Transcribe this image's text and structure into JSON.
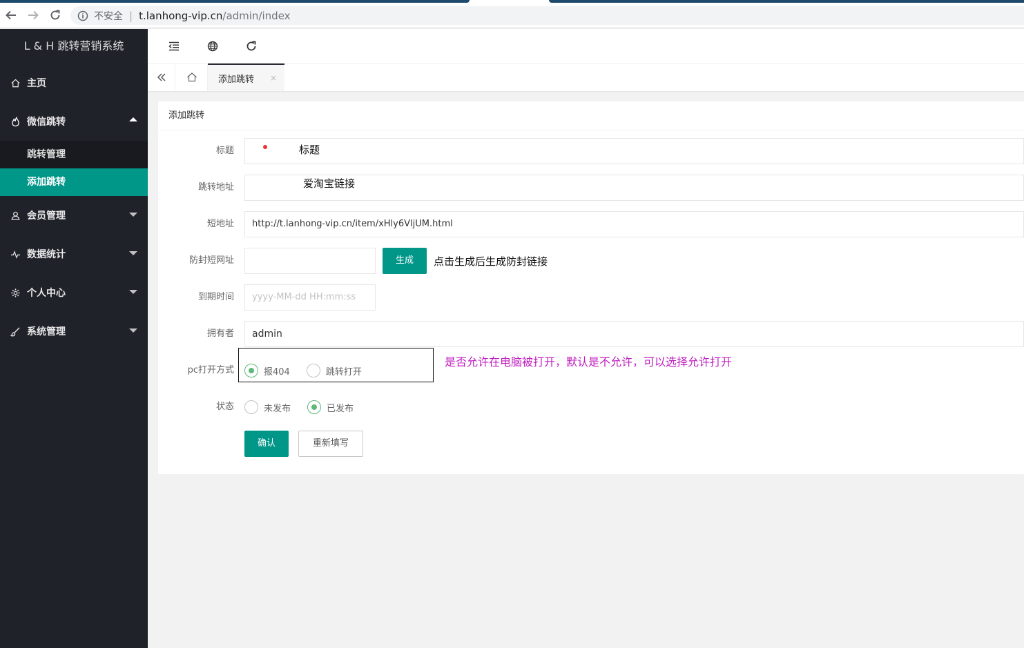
{
  "browser": {
    "insecure_label": "不安全",
    "url_host": "t.lanhong-vip.cn",
    "url_path": "/admin/index"
  },
  "sidebar": {
    "logo": "L & H 跳转营销系统",
    "items": [
      {
        "label": "主页",
        "icon": "home-icon"
      },
      {
        "label": "微信跳转",
        "icon": "fire-icon",
        "expanded": true
      },
      {
        "label": "会员管理",
        "icon": "user-icon"
      },
      {
        "label": "数据统计",
        "icon": "pulse-icon"
      },
      {
        "label": "个人中心",
        "icon": "gear-icon"
      },
      {
        "label": "系统管理",
        "icon": "brush-icon"
      }
    ],
    "submenu": [
      {
        "label": "跳转管理",
        "active": false
      },
      {
        "label": "添加跳转",
        "active": true
      }
    ]
  },
  "tabs": {
    "active_tab": "添加跳转",
    "close_glyph": "×"
  },
  "form": {
    "card_title": "添加跳转",
    "fields": {
      "title": {
        "label": "标题",
        "overlay": "标题"
      },
      "jump_url": {
        "label": "跳转地址",
        "overlay": "爱淘宝链接"
      },
      "short_url": {
        "label": "短地址",
        "value": "http://t.lanhong-vip.cn/item/xHly6VljUM.html"
      },
      "anti_block": {
        "label": "防封短网址",
        "button": "生成",
        "note": "点击生成后生成防封链接"
      },
      "expire": {
        "label": "到期时间",
        "placeholder": "yyyy-MM-dd HH:mm:ss"
      },
      "owner": {
        "label": "拥有者",
        "value": "admin"
      },
      "pc_open": {
        "label": "pc打开方式",
        "options": [
          "报404",
          "跳转打开"
        ],
        "selected": "报404",
        "note": "是否允许在电脑被打开，默认是不允许，可以选择允许打开"
      },
      "status": {
        "label": "状态",
        "options": [
          "未发布",
          "已发布"
        ],
        "selected": "已发布"
      }
    },
    "confirm": "确认",
    "reset": "重新填写"
  },
  "colors": {
    "accent": "#009688",
    "sidebar_bg": "#20222a",
    "radio_on": "#5fb878",
    "note_pink": "#c01ec0"
  }
}
